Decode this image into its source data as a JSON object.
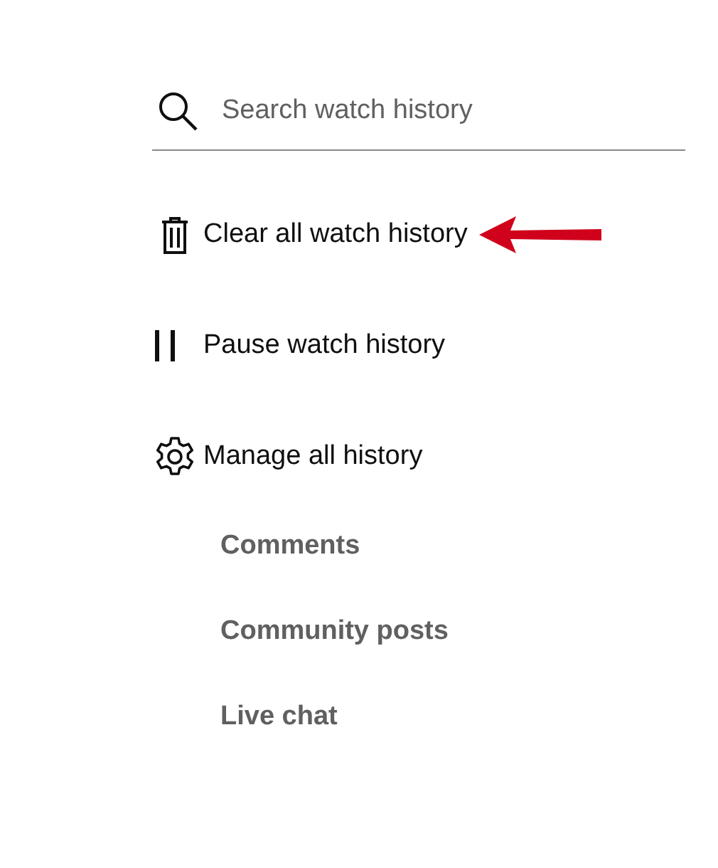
{
  "search": {
    "placeholder": "Search watch history"
  },
  "actions": [
    {
      "kind": "trash",
      "label": "Clear all watch history"
    },
    {
      "kind": "pause",
      "label": "Pause watch history"
    },
    {
      "kind": "gear",
      "label": "Manage all history"
    }
  ],
  "sub_items": [
    "Comments",
    "Community posts",
    "Live chat"
  ]
}
